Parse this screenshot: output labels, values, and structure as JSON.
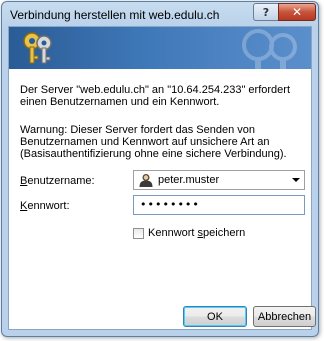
{
  "window": {
    "title": "Verbindung herstellen mit web.edulu.ch",
    "help_label": "?",
    "close_label": "✕"
  },
  "dialog": {
    "intro": "Der Server \"web.edulu.ch\" an \"10.64.254.233\" erfordert einen Benutzernamen und ein Kennwort.",
    "warning": "Warnung: Dieser Server fordert das Senden von Benutzernamen und Kennwort auf unsichere Art an (Basisauthentifizierung ohne eine sichere Verbindung)."
  },
  "form": {
    "username_label_accel": "B",
    "username_label_rest": "enutzername:",
    "username_value": "peter.muster",
    "password_label_accel": "K",
    "password_label_rest": "ennwort:",
    "password_value": "••••••••",
    "remember_label_pre": "Kennwort ",
    "remember_label_accel": "s",
    "remember_label_post": "peichern",
    "remember_checked": false
  },
  "buttons": {
    "ok": "OK",
    "cancel": "Abbrechen"
  },
  "icons": {
    "banner": "keys-icon",
    "user": "user-account-icon",
    "close": "close-icon",
    "help": "help-icon"
  }
}
